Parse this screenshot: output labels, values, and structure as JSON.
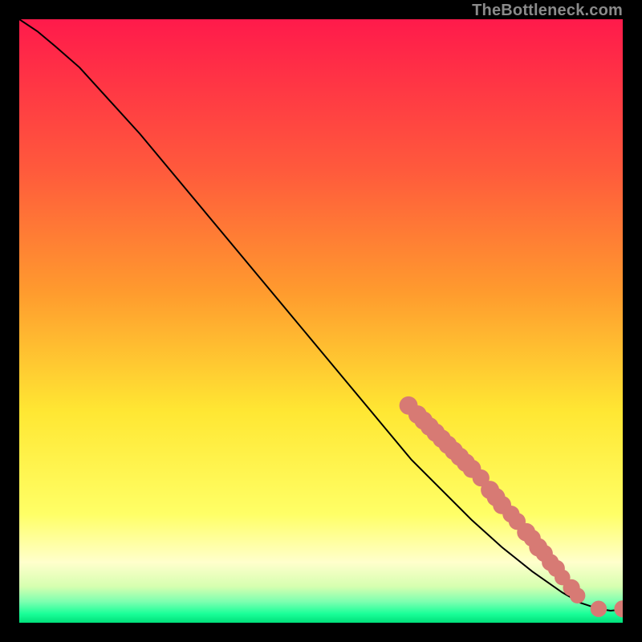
{
  "watermark": "TheBottleneck.com",
  "colors": {
    "gradient_stops": [
      {
        "offset": 0.0,
        "color": "#ff1a4b"
      },
      {
        "offset": 0.25,
        "color": "#ff5a3c"
      },
      {
        "offset": 0.45,
        "color": "#ff9a2e"
      },
      {
        "offset": 0.65,
        "color": "#ffe733"
      },
      {
        "offset": 0.82,
        "color": "#ffff66"
      },
      {
        "offset": 0.9,
        "color": "#ffffcc"
      },
      {
        "offset": 0.94,
        "color": "#d6ffb0"
      },
      {
        "offset": 0.965,
        "color": "#7dffb0"
      },
      {
        "offset": 0.985,
        "color": "#1aff99"
      },
      {
        "offset": 1.0,
        "color": "#00e07a"
      }
    ],
    "line": "#000000",
    "marker": "#d77a74",
    "background": "#000000"
  },
  "chart_data": {
    "type": "line",
    "title": "",
    "xlabel": "",
    "ylabel": "",
    "xlim": [
      0,
      100
    ],
    "ylim": [
      0,
      100
    ],
    "grid": false,
    "legend": false,
    "series": [
      {
        "name": "curve",
        "x": [
          0,
          3,
          6,
          10,
          15,
          20,
          25,
          30,
          35,
          40,
          45,
          50,
          55,
          60,
          65,
          70,
          75,
          80,
          85,
          90,
          93,
          96,
          98,
          100
        ],
        "y": [
          100,
          98,
          95.5,
          92,
          86.5,
          81,
          75,
          69,
          63,
          57,
          51,
          45,
          39,
          33,
          27,
          22,
          17,
          12.5,
          8.5,
          5,
          3.3,
          2.3,
          2.0,
          2.2
        ]
      }
    ],
    "markers": [
      {
        "x": 64.5,
        "y": 36.0,
        "r": 1.8
      },
      {
        "x": 66.0,
        "y": 34.5,
        "r": 1.8
      },
      {
        "x": 67.0,
        "y": 33.5,
        "r": 1.8
      },
      {
        "x": 68.0,
        "y": 32.5,
        "r": 1.8
      },
      {
        "x": 69.0,
        "y": 31.5,
        "r": 1.8
      },
      {
        "x": 70.0,
        "y": 30.5,
        "r": 1.8
      },
      {
        "x": 71.0,
        "y": 29.5,
        "r": 1.8
      },
      {
        "x": 72.0,
        "y": 28.5,
        "r": 1.8
      },
      {
        "x": 73.0,
        "y": 27.5,
        "r": 1.8
      },
      {
        "x": 74.0,
        "y": 26.5,
        "r": 1.8
      },
      {
        "x": 75.0,
        "y": 25.5,
        "r": 1.8
      },
      {
        "x": 76.5,
        "y": 24.0,
        "r": 1.6
      },
      {
        "x": 78.0,
        "y": 22.0,
        "r": 1.8
      },
      {
        "x": 79.0,
        "y": 20.8,
        "r": 1.8
      },
      {
        "x": 80.0,
        "y": 19.5,
        "r": 1.8
      },
      {
        "x": 81.5,
        "y": 18.0,
        "r": 1.6
      },
      {
        "x": 82.5,
        "y": 16.8,
        "r": 1.6
      },
      {
        "x": 84.0,
        "y": 15.0,
        "r": 1.8
      },
      {
        "x": 85.0,
        "y": 14.0,
        "r": 1.6
      },
      {
        "x": 86.0,
        "y": 12.5,
        "r": 1.8
      },
      {
        "x": 87.0,
        "y": 11.5,
        "r": 1.6
      },
      {
        "x": 88.0,
        "y": 10.0,
        "r": 1.6
      },
      {
        "x": 89.0,
        "y": 9.0,
        "r": 1.6
      },
      {
        "x": 90.0,
        "y": 7.5,
        "r": 1.4
      },
      {
        "x": 91.5,
        "y": 5.8,
        "r": 1.6
      },
      {
        "x": 92.5,
        "y": 4.5,
        "r": 1.4
      },
      {
        "x": 96.0,
        "y": 2.3,
        "r": 1.5
      },
      {
        "x": 100.0,
        "y": 2.3,
        "r": 1.6
      }
    ]
  }
}
